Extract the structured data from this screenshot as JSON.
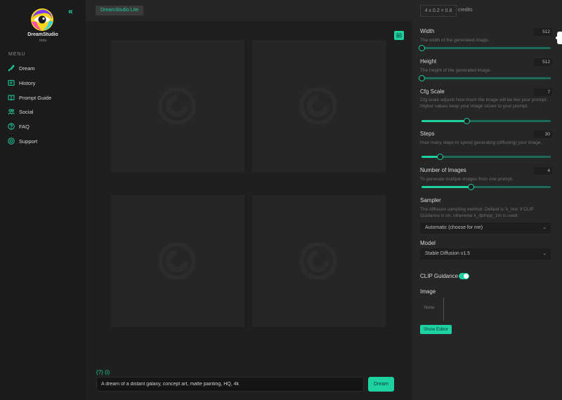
{
  "sidebar": {
    "brand": "DreamStudio",
    "brand_sub": "beta",
    "menu_header": "MENU",
    "items": [
      {
        "label": "Dream",
        "icon": "paint-brush-icon"
      },
      {
        "label": "History",
        "icon": "history-icon"
      },
      {
        "label": "Prompt Guide",
        "icon": "book-icon"
      },
      {
        "label": "Social",
        "icon": "people-icon"
      },
      {
        "label": "FAQ",
        "icon": "question-icon"
      },
      {
        "label": "Support",
        "icon": "support-icon"
      }
    ]
  },
  "topbar": {
    "project": "DreamStudio Lite"
  },
  "prompt": {
    "hint": "(?) (i)",
    "value": "A dream of a distant galaxy, concept art, matte painting, HQ, 4k",
    "submit_label": "Dream"
  },
  "settings": {
    "credits_value": "4 x 0.2 = 0.8",
    "credits_label": "credits",
    "width": {
      "label": "Width",
      "desc": "The width of the generated image.",
      "value": "512",
      "fraction": 0.0
    },
    "height": {
      "label": "Height",
      "desc": "The height of the generated image.",
      "value": "512",
      "fraction": 0.0
    },
    "cfg": {
      "label": "Cfg Scale",
      "desc": "Cfg scale adjusts how much the image will be like your prompt. Higher values keep your image closer to your prompt.",
      "value": "7",
      "fraction": 0.35
    },
    "steps": {
      "label": "Steps",
      "desc": "How many steps to spend generating (diffusing) your image.",
      "value": "30",
      "fraction": 0.14
    },
    "images": {
      "label": "Number of Images",
      "desc": "To generate multiple images from one prompt.",
      "value": "4",
      "fraction": 0.38
    },
    "sampler": {
      "label": "Sampler",
      "desc": "The diffusion sampling method. Default is 'k_lms' if CLIP Guidance is on, otherwise k_dpmpp_2m is used.",
      "value": "Automatic (choose for me)"
    },
    "model": {
      "label": "Model",
      "value": "Stable Diffusion v1.5"
    },
    "clip": {
      "label": "CLIP Guidance",
      "on": true
    },
    "image": {
      "label": "Image",
      "placeholder": "None"
    },
    "show_editor_label": "Show Editor"
  },
  "colors": {
    "accent": "#1dd1a1",
    "sidebar": "#1b1b1b",
    "panel": "#262626",
    "canvas": "#1f1f1f"
  }
}
